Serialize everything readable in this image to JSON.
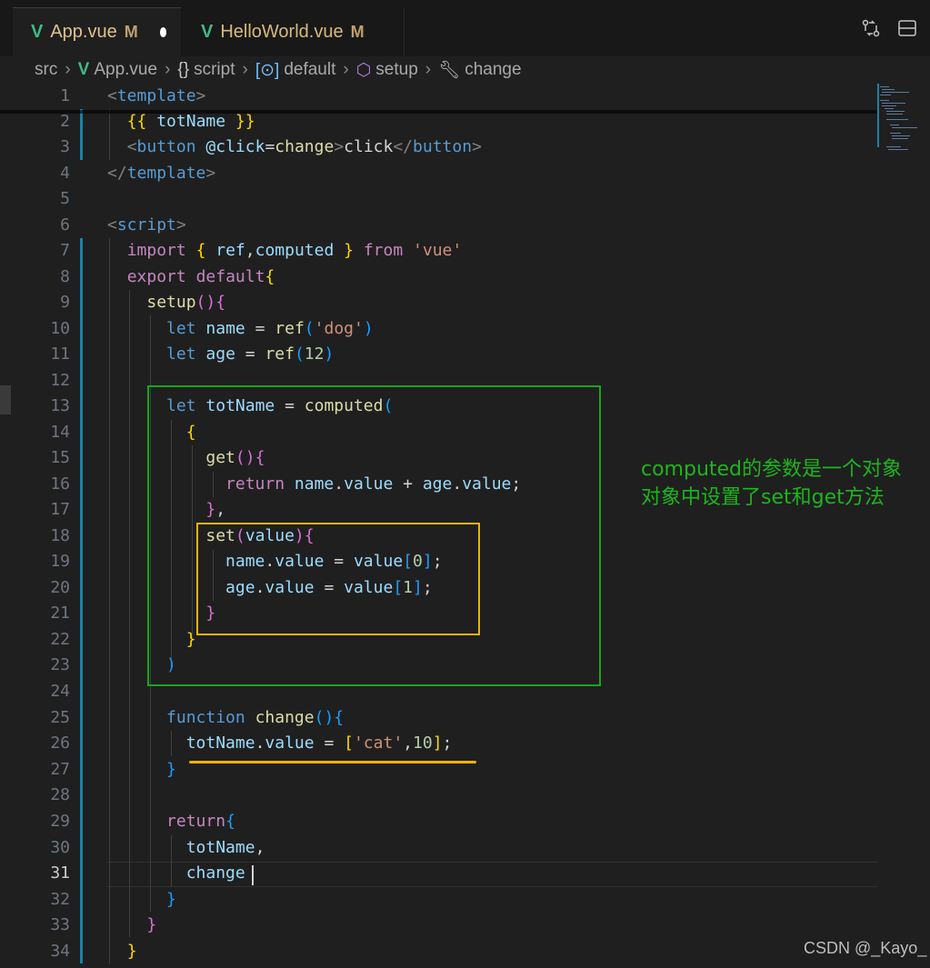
{
  "tabs": [
    {
      "icon": "vue-icon",
      "label": "App.vue",
      "status": "M",
      "active": true,
      "dirty": true
    },
    {
      "icon": "vue-icon",
      "label": "HelloWorld.vue",
      "status": "M",
      "active": false
    }
  ],
  "tab_actions": [
    "compare-changes-icon",
    "split-editor-icon"
  ],
  "breadcrumb": {
    "items": [
      "src",
      "App.vue",
      "script",
      "default",
      "setup",
      "change"
    ]
  },
  "editor": {
    "current_line": 31,
    "line_numbers": [
      "1",
      "2",
      "3",
      "4",
      "5",
      "6",
      "7",
      "8",
      "9",
      "10",
      "11",
      "12",
      "13",
      "14",
      "15",
      "16",
      "17",
      "18",
      "19",
      "20",
      "21",
      "22",
      "23",
      "24",
      "25",
      "26",
      "27",
      "28",
      "29",
      "30",
      "31",
      "32",
      "33",
      "34"
    ]
  },
  "annotation": {
    "line1": "computed的参数是一个对象",
    "line2": "对象中设置了set和get方法"
  },
  "watermark": "CSDN @_Kayo_",
  "colors": {
    "green_box": "#1aa51a",
    "orange_box": "#f0b400",
    "annotation_text": "#1db51d"
  }
}
